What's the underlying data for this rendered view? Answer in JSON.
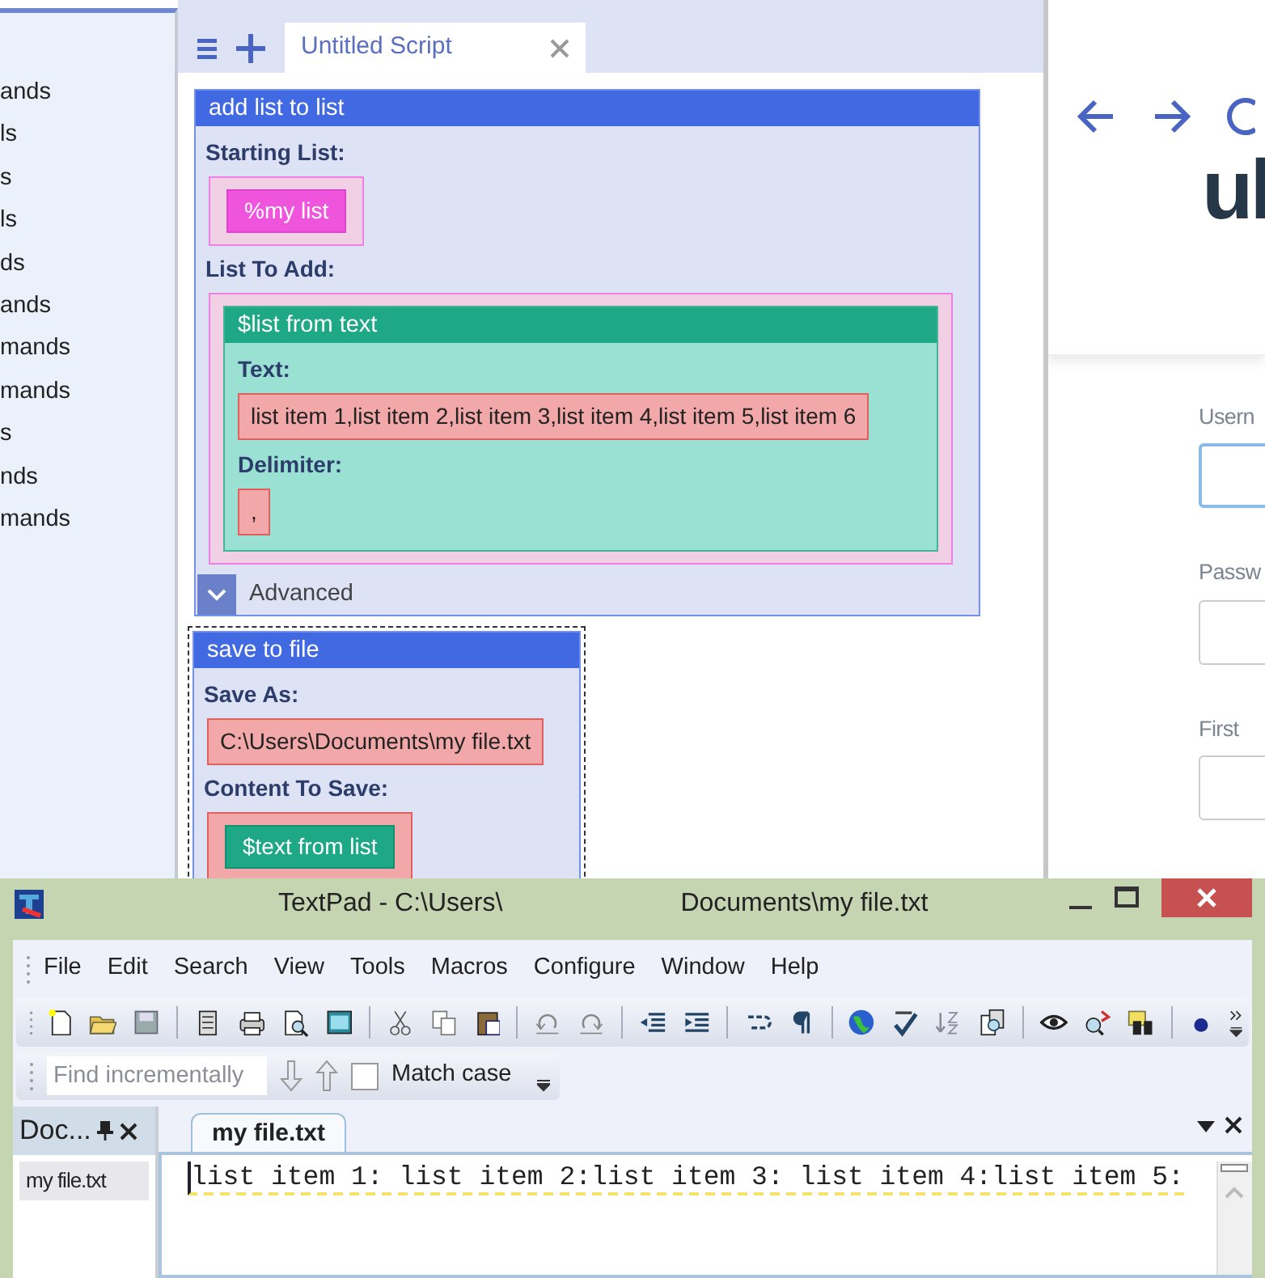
{
  "sidebar": {
    "items": [
      {
        "label": "ands"
      },
      {
        "label": "ls"
      },
      {
        "label": "s"
      },
      {
        "label": "ls"
      },
      {
        "label": "ds"
      },
      {
        "label": "ands"
      },
      {
        "label": "mands"
      },
      {
        "label": "mands"
      },
      {
        "label": "s"
      },
      {
        "label": "nds"
      },
      {
        "label": "mands"
      }
    ]
  },
  "script_tabs": [
    {
      "label": "Untitled Script",
      "selected": true
    }
  ],
  "blocks": [
    {
      "title": "add list to list",
      "selected": false,
      "params": [
        {
          "label": "Starting List:",
          "value": {
            "kind": "list_slot",
            "item": {
              "kind": "variable",
              "text": "%my list"
            }
          }
        },
        {
          "label": "List To Add:",
          "value": {
            "kind": "list_slot",
            "item": {
              "kind": "block",
              "title": "$list from text",
              "params": [
                {
                  "label": "Text:",
                  "value": {
                    "kind": "text",
                    "text": "list item 1,list item 2,list item 3,list item 4,list item 5,list item 6"
                  }
                },
                {
                  "label": "Delimiter:",
                  "value": {
                    "kind": "text",
                    "text": ","
                  }
                }
              ]
            }
          }
        }
      ],
      "advanced": {
        "label": "Advanced",
        "expanded": false
      }
    },
    {
      "title": "save to file",
      "selected": true,
      "params": [
        {
          "label": "Save As:",
          "value": {
            "kind": "text",
            "text": "C:\\Users\\Documents\\my file.txt"
          }
        },
        {
          "label": "Content To Save:",
          "value": {
            "kind": "text_slot",
            "item": {
              "kind": "function",
              "text": "$text from list"
            }
          }
        }
      ]
    }
  ],
  "browser": {
    "logo": "ul",
    "fields": [
      {
        "label": "Usern",
        "focused": true
      },
      {
        "label": "Passw",
        "focused": false
      },
      {
        "label": "First",
        "focused": false
      }
    ]
  },
  "textpad": {
    "title": [
      "TextPad - C:\\Users\\",
      "Documents\\my file.txt"
    ],
    "menu": [
      "File",
      "Edit",
      "Search",
      "View",
      "Tools",
      "Macros",
      "Configure",
      "Window",
      "Help"
    ],
    "find": {
      "placeholder": "Find incrementally"
    },
    "match_case": {
      "label": "Match case",
      "checked": false
    },
    "documents_panel": {
      "title": "Doc...",
      "items": [
        {
          "label": "my file.txt",
          "selected": true
        }
      ]
    },
    "editor_tabs": [
      {
        "label": "my file.txt",
        "selected": true
      }
    ],
    "editor_lines": [
      "list item 1: list item 2:list item 3: list item 4:list item 5:"
    ]
  }
}
